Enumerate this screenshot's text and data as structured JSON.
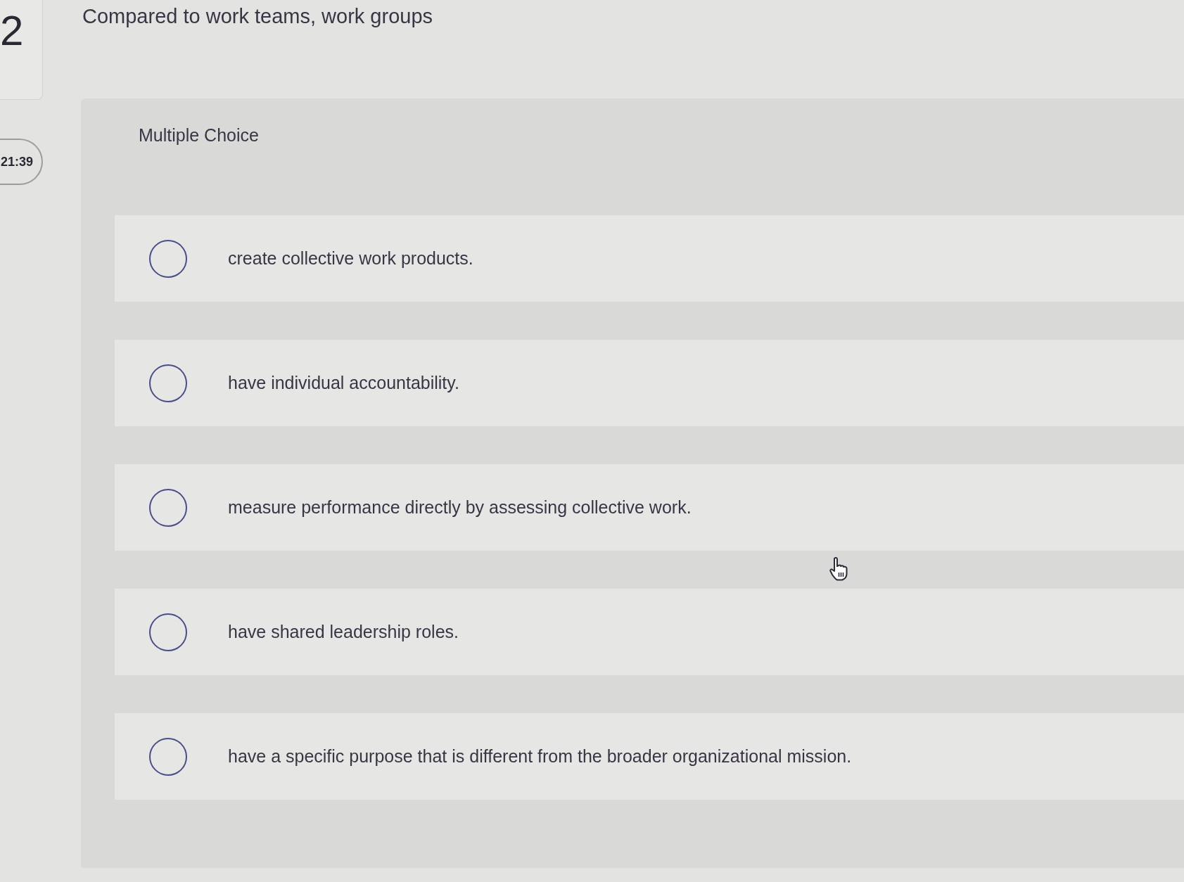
{
  "question": {
    "number": "2",
    "text": "Compared to work teams, work groups"
  },
  "timer": "21:39",
  "question_type": "Multiple Choice",
  "choices": [
    {
      "text": "create collective work products.",
      "selected": false
    },
    {
      "text": "have individual accountability.",
      "selected": false
    },
    {
      "text": "measure performance directly by assessing collective work.",
      "selected": false
    },
    {
      "text": "have shared leadership roles.",
      "selected": false
    },
    {
      "text": "have a specific purpose that is different from the broader organizational mission.",
      "selected": false
    }
  ]
}
